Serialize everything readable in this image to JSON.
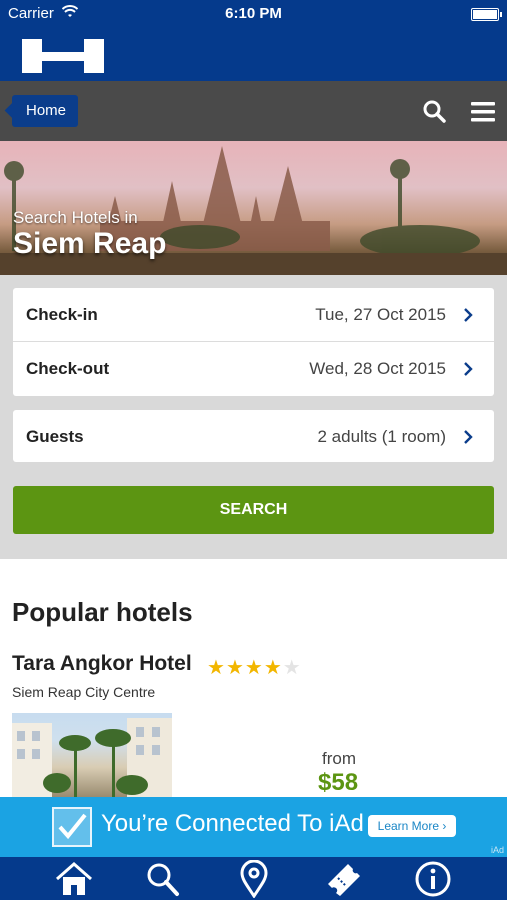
{
  "status_bar": {
    "carrier": "Carrier",
    "time": "6:10 PM",
    "wifi_icon": "wifi-icon",
    "battery_icon": "battery-icon"
  },
  "brand": {
    "logo_icon": "hotels-h-logo"
  },
  "nav": {
    "home_label": "Home",
    "search_icon": "search-icon",
    "menu_icon": "hamburger-menu-icon"
  },
  "hero": {
    "subtitle": "Search Hotels in",
    "city": "Siem Reap"
  },
  "booking": {
    "checkin": {
      "label": "Check-in",
      "value": "Tue, 27 Oct 2015"
    },
    "checkout": {
      "label": "Check-out",
      "value": "Wed, 28 Oct 2015"
    },
    "guests": {
      "label": "Guests",
      "value": "2 adults (1 room)"
    },
    "search_label": "SEARCH"
  },
  "popular": {
    "heading": "Popular hotels",
    "hotels": [
      {
        "name": "Tara Angkor Hotel",
        "stars": 4,
        "max_stars": 5,
        "area": "Siem Reap City Centre",
        "from_label": "from",
        "price": "$58"
      }
    ]
  },
  "ad": {
    "message": "You’re Connected To iAd",
    "button": "Learn More ›",
    "tag": "iAd"
  },
  "tabbar": {
    "items": [
      "home-icon",
      "search-icon",
      "location-pin-icon",
      "ticket-icon",
      "info-icon"
    ]
  },
  "colors": {
    "brand_blue": "#053a8c",
    "action_green": "#5c9512",
    "star_gold": "#f2b600",
    "iad_blue": "#1ba3e3"
  }
}
